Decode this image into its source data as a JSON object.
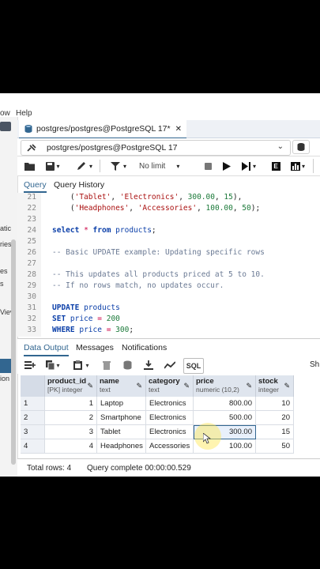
{
  "menubar": {
    "items": [
      "ow",
      "Help"
    ]
  },
  "left_panel": {
    "labels": [
      "atic",
      "ries",
      "es",
      "s",
      "Viev",
      "ion"
    ]
  },
  "query_tab": {
    "title": "postgres/postgres@PostgreSQL 17*",
    "close": "✕"
  },
  "connection": {
    "value": "postgres/postgres@PostgreSQL 17"
  },
  "toolbar": {
    "limit_label": "No limit"
  },
  "query_tabs": [
    "Query",
    "Query History"
  ],
  "editor": {
    "line_numbers": [
      "21",
      "22",
      "23",
      "24",
      "25",
      "26",
      "27",
      "28",
      "29",
      "30",
      "31",
      "32",
      "33"
    ]
  },
  "output_tabs": [
    "Data Output",
    "Messages",
    "Notifications"
  ],
  "output_toolbar": {
    "sql_label": "SQL",
    "sh_label": "Sh"
  },
  "grid": {
    "columns": [
      {
        "name": "product_id",
        "type": "[PK] integer"
      },
      {
        "name": "name",
        "type": "text"
      },
      {
        "name": "category",
        "type": "text"
      },
      {
        "name": "price",
        "type": "numeric (10,2)"
      },
      {
        "name": "stock",
        "type": "integer"
      }
    ],
    "rows": [
      {
        "n": "1",
        "id": "1",
        "name": "Laptop",
        "category": "Electronics",
        "price": "800.00",
        "stock": "10"
      },
      {
        "n": "2",
        "id": "2",
        "name": "Smartphone",
        "category": "Electronics",
        "price": "500.00",
        "stock": "20"
      },
      {
        "n": "3",
        "id": "3",
        "name": "Tablet",
        "category": "Electronics",
        "price": "300.00",
        "stock": "15"
      },
      {
        "n": "4",
        "id": "4",
        "name": "Headphones",
        "category": "Accessories",
        "price": "100.00",
        "stock": "50"
      }
    ]
  },
  "status": {
    "total_rows": "Total rows: 4",
    "query_complete": "Query complete 00:00:00.529"
  },
  "colors": {
    "accent": "#326690",
    "header_bg": "#dfe5ee"
  }
}
